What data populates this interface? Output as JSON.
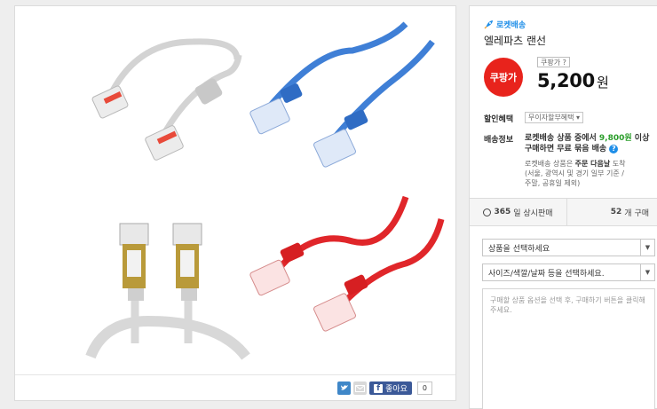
{
  "product": {
    "delivery_badge": "로켓배송",
    "name": "엘레파츠 랜선",
    "coupang_badge": "쿠팡가",
    "coupang_tag": "쿠팡가 ?",
    "price": "5,200",
    "currency": "원"
  },
  "discount": {
    "label": "할인혜택",
    "option": "무이자할부혜택 ▾"
  },
  "shipping": {
    "label": "배송정보",
    "line1_pre": "로켓배송 상품 중에서 ",
    "line1_amount": "9,800원",
    "line1_post": " 이상 구매하면 무료 묶음 배송",
    "line2_pre": "로켓배송 상품은 ",
    "line2_bold": "주문 다음날",
    "line2_post": " 도착",
    "line3": "(서울, 광역시 및 경기 일부 기준 /",
    "line4": "주말, 공휴일 제외)"
  },
  "stats": {
    "days": "365",
    "days_suffix": "일 상시판매",
    "count": "52",
    "count_suffix": "개 구매"
  },
  "options": {
    "select1": "상품을 선택하세요",
    "select2": "사이즈/색깔/날짜 등을 선택하세요.",
    "memo": "구매할 상품 옵션을 선택 후, 구매하기 버튼을 클릭해주세요."
  },
  "share": {
    "like_label": "좋아요",
    "like_count": "0"
  },
  "colors": {
    "accent_red": "#e8231c",
    "rocket_blue": "#1e8ee8",
    "free_green": "#2a9d2a",
    "cable_gray": "#cfcfcf",
    "cable_blue": "#3f7fd6",
    "cable_red": "#e0262a"
  }
}
